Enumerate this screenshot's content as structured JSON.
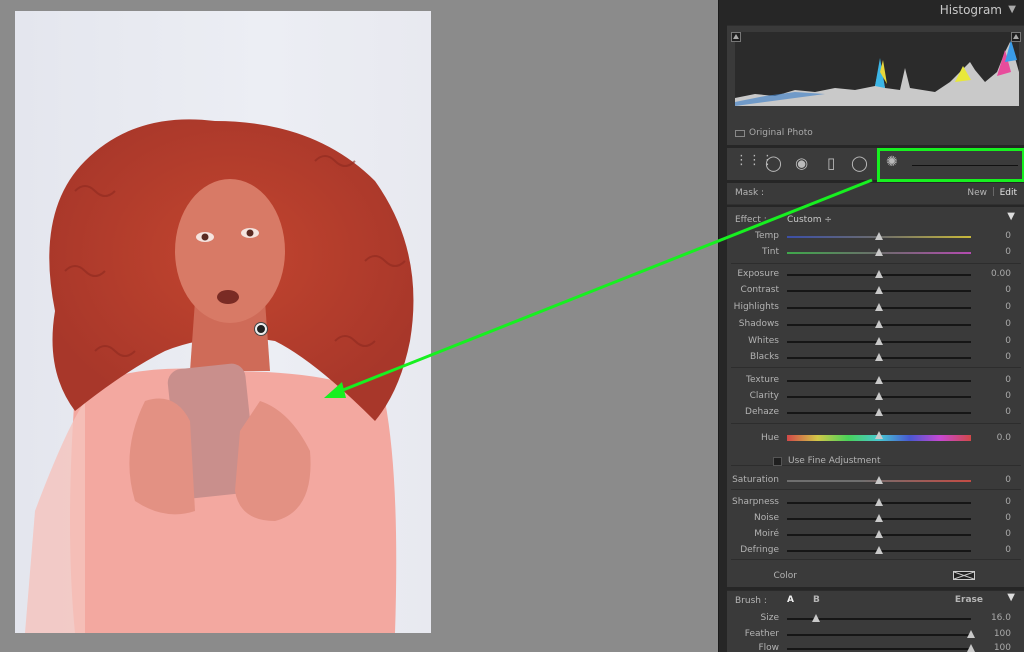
{
  "histogram": {
    "title": "Histogram",
    "original_photo_label": "Original Photo"
  },
  "mask": {
    "label": "Mask :",
    "new_label": "New",
    "separator": "|",
    "edit_label": "Edit"
  },
  "effect": {
    "label": "Effect :",
    "value": "Custom ÷"
  },
  "sliders": [
    {
      "label": "Temp",
      "value": "0",
      "pos": 0.5
    },
    {
      "label": "Tint",
      "value": "0",
      "pos": 0.5
    },
    {
      "label": "Exposure",
      "value": "0.00",
      "pos": 0.5
    },
    {
      "label": "Contrast",
      "value": "0",
      "pos": 0.5
    },
    {
      "label": "Highlights",
      "value": "0",
      "pos": 0.5
    },
    {
      "label": "Shadows",
      "value": "0",
      "pos": 0.5
    },
    {
      "label": "Whites",
      "value": "0",
      "pos": 0.5
    },
    {
      "label": "Blacks",
      "value": "0",
      "pos": 0.5
    },
    {
      "label": "Texture",
      "value": "0",
      "pos": 0.5
    },
    {
      "label": "Clarity",
      "value": "0",
      "pos": 0.5
    },
    {
      "label": "Dehaze",
      "value": "0",
      "pos": 0.5
    },
    {
      "label": "Hue",
      "value": "0.0",
      "pos": 0.5
    },
    {
      "label": "Saturation",
      "value": "0",
      "pos": 0.5
    },
    {
      "label": "Sharpness",
      "value": "0",
      "pos": 0.5
    },
    {
      "label": "Noise",
      "value": "0",
      "pos": 0.5
    },
    {
      "label": "Moiré",
      "value": "0",
      "pos": 0.5
    },
    {
      "label": "Defringe",
      "value": "0",
      "pos": 0.5
    }
  ],
  "fine_adjustment_label": "Use Fine Adjustment",
  "color_label": "Color",
  "brush": {
    "label": "Brush :",
    "a": "A",
    "b": "B",
    "erase": "Erase",
    "sliders": [
      {
        "label": "Size",
        "value": "16.0",
        "pos": 0.16
      },
      {
        "label": "Feather",
        "value": "100",
        "pos": 1.0
      },
      {
        "label": "Flow",
        "value": "100",
        "pos": 1.0
      }
    ]
  },
  "colors": {
    "highlight": "#17f020",
    "mask_overlay": "#e03c2c"
  }
}
